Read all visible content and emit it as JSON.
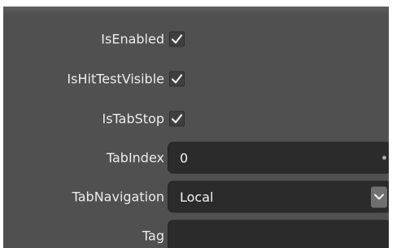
{
  "properties": {
    "is_enabled": {
      "label": "IsEnabled",
      "checked": true
    },
    "is_hit_test_visible": {
      "label": "IsHitTestVisible",
      "checked": true
    },
    "is_tab_stop": {
      "label": "IsTabStop",
      "checked": true
    },
    "tab_index": {
      "label": "TabIndex",
      "value": "0"
    },
    "tab_navigation": {
      "label": "TabNavigation",
      "value": "Local"
    },
    "tag": {
      "label": "Tag",
      "value": ""
    }
  },
  "icons": {
    "check": "check-icon",
    "dropdown": "chevron-down-icon"
  },
  "colors": {
    "panel_background": "#505050",
    "field_background": "#2b2b2b",
    "text": "#ececec"
  }
}
